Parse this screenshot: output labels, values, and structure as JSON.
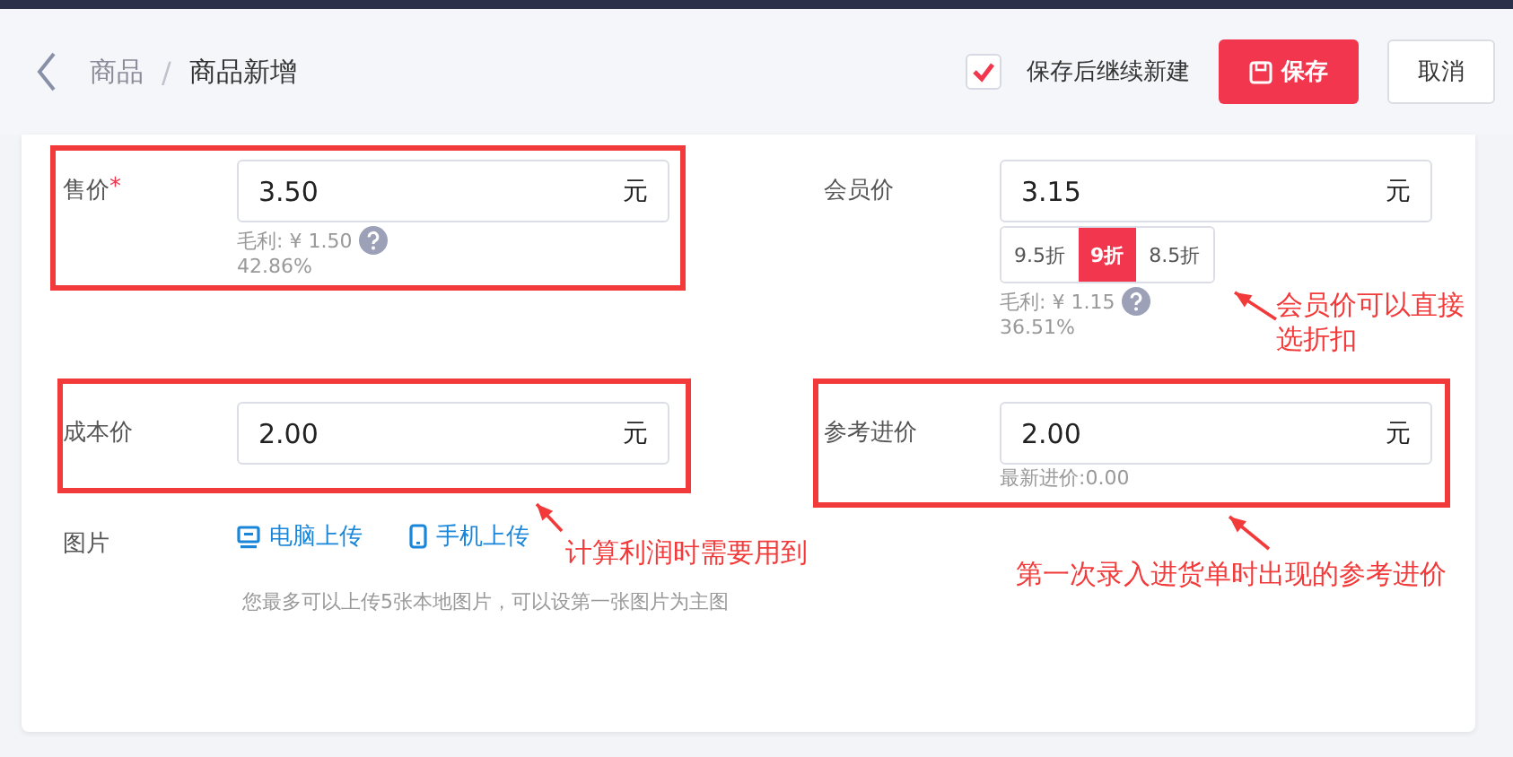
{
  "header": {
    "breadcrumb": [
      {
        "label": "商品",
        "current": false
      },
      {
        "label": "商品新增",
        "current": true
      }
    ],
    "breadcrumb_separator": "/",
    "continue_option": {
      "label": "保存后继续新建",
      "checked": true
    },
    "save_button": "保存",
    "cancel_button": "取消"
  },
  "fields": [
    {
      "label": "售价",
      "required_mark": "*",
      "value": "3.50",
      "unit": "元",
      "profit": "毛利: ¥ 1.50",
      "profit_rate": "42.86%"
    },
    {
      "label": "会员价",
      "value": "3.15",
      "unit": "元",
      "discounts": [
        {
          "label": "9.5折",
          "selected": false
        },
        {
          "label": "9折",
          "selected": true
        },
        {
          "label": "8.5折",
          "selected": false
        }
      ],
      "profit": "毛利: ¥ 1.15",
      "profit_rate": "36.51%"
    },
    {
      "label": "成本价",
      "value": "2.00",
      "unit": "元"
    },
    {
      "label": "参考进价",
      "value": "2.00",
      "unit": "元",
      "note": "最新进价:0.00"
    }
  ],
  "images": {
    "label": "图片",
    "upload_links": [
      {
        "kind": "computer",
        "label": "电脑上传"
      },
      {
        "kind": "phone",
        "label": "手机上传"
      }
    ],
    "hint": "您最多可以上传5张本地图片，可以设第一张图片为主图"
  },
  "annotations": [
    {
      "lines": [
        "会员价可以直接",
        "选折扣"
      ]
    },
    {
      "lines": [
        "计算利润时需要用到"
      ]
    },
    {
      "lines": [
        "第一次录入进货单时出现的参考进价"
      ]
    }
  ]
}
